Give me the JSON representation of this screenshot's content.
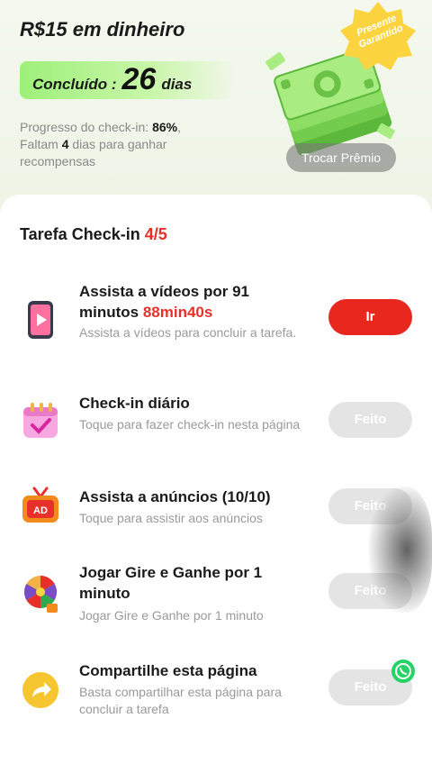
{
  "header": {
    "reward_title": "R$15 em dinheiro",
    "completed_label": "Concluído :",
    "completed_days": "26",
    "completed_unit": "dias",
    "progress_label": "Progresso do check-in:",
    "progress_percent": "86%",
    "progress_fraction": 0.86,
    "remaining_prefix": "Faltam",
    "remaining_days": "4",
    "remaining_suffix": "dias para ganhar recompensas",
    "badge_text": "Presente Garantido",
    "trade_button": "Trocar Prêmio"
  },
  "tasks_section": {
    "title": "Tarefa Check-in",
    "count": "4/5",
    "tasks": [
      {
        "icon": "video-phone-icon",
        "title": "Assista a vídeos por 91 minutos",
        "time": "88min40s",
        "description": "Assista a vídeos para concluir a tarefa.",
        "button": "Ir",
        "state": "pending"
      },
      {
        "icon": "calendar-check-icon",
        "title": "Check-in diário",
        "time": "",
        "description": "Toque para fazer check-in nesta página",
        "button": "Feito",
        "state": "done"
      },
      {
        "icon": "tv-ad-icon",
        "title": "Assista a anúncios (10/10)",
        "time": "",
        "description": "Toque para assistir aos anúncios",
        "button": "Feito",
        "state": "done"
      },
      {
        "icon": "prize-wheel-icon",
        "title": "Jogar Gire e Ganhe por 1 minuto",
        "time": "",
        "description": "Jogar Gire e Ganhe por 1 minuto",
        "button": "Feito",
        "state": "done"
      },
      {
        "icon": "share-arrow-icon",
        "title": "Compartilhe esta página",
        "time": "",
        "description": "Basta compartilhar esta página para concluir a tarefa",
        "button": "Feito",
        "state": "done"
      }
    ]
  },
  "colors": {
    "accent_red": "#e8281e",
    "pill_green": "#9ef07a",
    "done_gray": "#e4e4e4"
  }
}
